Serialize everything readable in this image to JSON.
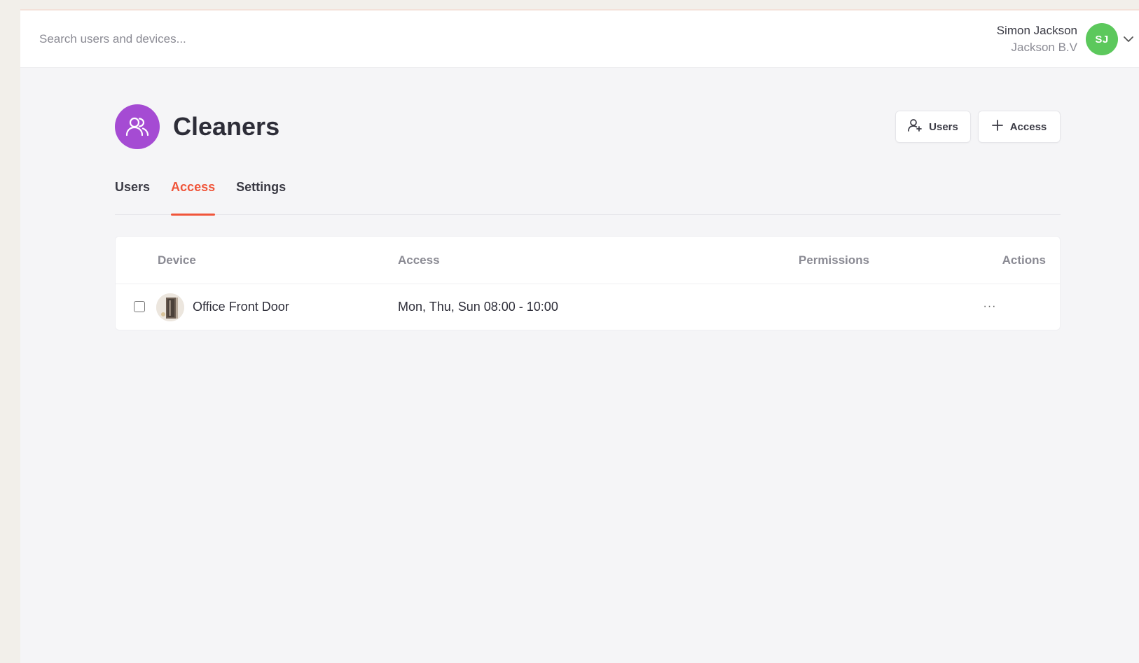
{
  "topbar": {
    "search_placeholder": "Search users and devices...",
    "user_name": "Simon Jackson",
    "user_company": "Jackson B.V",
    "avatar_initials": "SJ",
    "avatar_color": "#5cc85c"
  },
  "header": {
    "title": "Cleaners",
    "group_icon": "users-group-icon",
    "group_icon_color": "#a54bd3",
    "users_button_label": "Users",
    "access_button_label": "Access"
  },
  "tabs": [
    {
      "label": "Users",
      "active": false
    },
    {
      "label": "Access",
      "active": true
    },
    {
      "label": "Settings",
      "active": false
    }
  ],
  "accent_color": "#f0553a",
  "table": {
    "columns": {
      "device": "Device",
      "access": "Access",
      "permissions": "Permissions",
      "actions": "Actions"
    },
    "rows": [
      {
        "device": "Office Front Door",
        "access": "Mon, Thu, Sun 08:00 - 10:00",
        "permissions": "",
        "actions_label": "···"
      }
    ]
  }
}
